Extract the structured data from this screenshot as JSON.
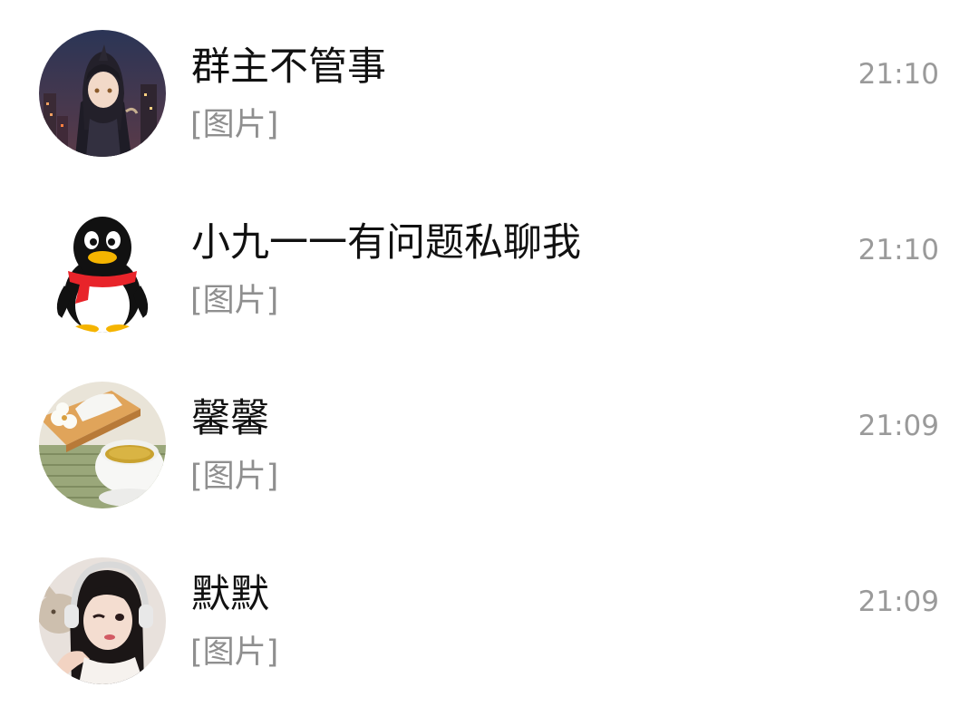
{
  "chats": [
    {
      "name": "群主不管事",
      "preview": "[图片]",
      "time": "21:10",
      "avatar": "anime-girl-avatar"
    },
    {
      "name": "小九一一有问题私聊我",
      "preview": "[图片]",
      "time": "21:10",
      "avatar": "qq-penguin-avatar"
    },
    {
      "name": "馨馨",
      "preview": "[图片]",
      "time": "21:09",
      "avatar": "tea-cup-avatar"
    },
    {
      "name": "默默",
      "preview": "[图片]",
      "time": "21:09",
      "avatar": "girl-headphones-avatar"
    }
  ],
  "colors": {
    "name_text": "#111111",
    "preview_text": "#8f8f8f",
    "time_text": "#9a9a9a",
    "background": "#ffffff"
  }
}
